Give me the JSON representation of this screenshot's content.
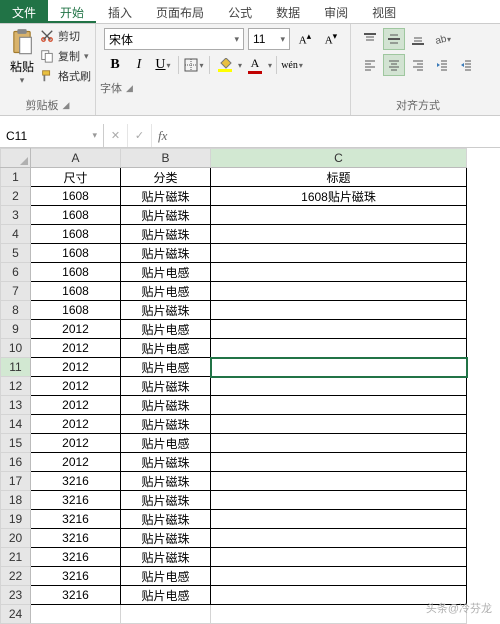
{
  "tabs": {
    "file": "文件",
    "home": "开始",
    "insert": "插入",
    "layout": "页面布局",
    "formulas": "公式",
    "data": "数据",
    "review": "审阅",
    "view": "视图"
  },
  "ribbon": {
    "clipboard": {
      "paste": "粘贴",
      "cut": "剪切",
      "copy": "复制",
      "format_painter": "格式刷",
      "group_label": "剪贴板"
    },
    "font": {
      "name": "宋体",
      "size": "11",
      "group_label": "字体",
      "phonetic": "wén"
    },
    "align": {
      "group_label": "对齐方式"
    }
  },
  "name_box": "C11",
  "formula_bar": "",
  "columns": [
    "A",
    "B",
    "C"
  ],
  "headers": {
    "A": "尺寸",
    "B": "分类",
    "C": "标题"
  },
  "rows": [
    {
      "r": 1,
      "A": "尺寸",
      "B": "分类",
      "C": "标题"
    },
    {
      "r": 2,
      "A": "1608",
      "B": "贴片磁珠",
      "C": "1608贴片磁珠"
    },
    {
      "r": 3,
      "A": "1608",
      "B": "贴片磁珠",
      "C": ""
    },
    {
      "r": 4,
      "A": "1608",
      "B": "贴片磁珠",
      "C": ""
    },
    {
      "r": 5,
      "A": "1608",
      "B": "贴片磁珠",
      "C": ""
    },
    {
      "r": 6,
      "A": "1608",
      "B": "贴片电感",
      "C": ""
    },
    {
      "r": 7,
      "A": "1608",
      "B": "贴片电感",
      "C": ""
    },
    {
      "r": 8,
      "A": "1608",
      "B": "贴片磁珠",
      "C": ""
    },
    {
      "r": 9,
      "A": "2012",
      "B": "贴片电感",
      "C": ""
    },
    {
      "r": 10,
      "A": "2012",
      "B": "贴片电感",
      "C": ""
    },
    {
      "r": 11,
      "A": "2012",
      "B": "贴片电感",
      "C": ""
    },
    {
      "r": 12,
      "A": "2012",
      "B": "贴片磁珠",
      "C": ""
    },
    {
      "r": 13,
      "A": "2012",
      "B": "贴片磁珠",
      "C": ""
    },
    {
      "r": 14,
      "A": "2012",
      "B": "贴片磁珠",
      "C": ""
    },
    {
      "r": 15,
      "A": "2012",
      "B": "贴片电感",
      "C": ""
    },
    {
      "r": 16,
      "A": "2012",
      "B": "贴片磁珠",
      "C": ""
    },
    {
      "r": 17,
      "A": "3216",
      "B": "贴片磁珠",
      "C": ""
    },
    {
      "r": 18,
      "A": "3216",
      "B": "贴片磁珠",
      "C": ""
    },
    {
      "r": 19,
      "A": "3216",
      "B": "贴片磁珠",
      "C": ""
    },
    {
      "r": 20,
      "A": "3216",
      "B": "贴片磁珠",
      "C": ""
    },
    {
      "r": 21,
      "A": "3216",
      "B": "贴片磁珠",
      "C": ""
    },
    {
      "r": 22,
      "A": "3216",
      "B": "贴片电感",
      "C": ""
    },
    {
      "r": 23,
      "A": "3216",
      "B": "贴片电感",
      "C": ""
    },
    {
      "r": 24,
      "A": "",
      "B": "",
      "C": ""
    }
  ],
  "selected_cell": {
    "row": 11,
    "col": "C"
  },
  "watermark": "头条@冷芬龙"
}
